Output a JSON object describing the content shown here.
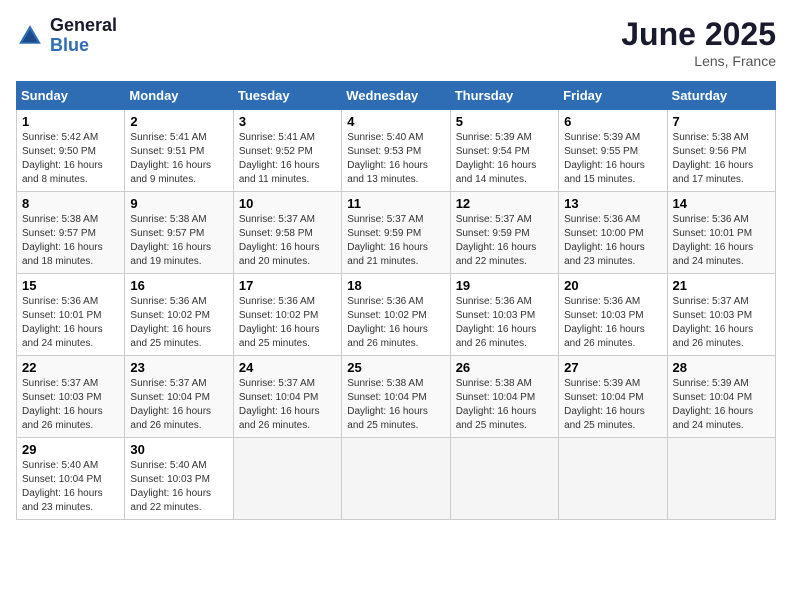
{
  "header": {
    "logo_general": "General",
    "logo_blue": "Blue",
    "month_title": "June 2025",
    "location": "Lens, France"
  },
  "weekdays": [
    "Sunday",
    "Monday",
    "Tuesday",
    "Wednesday",
    "Thursday",
    "Friday",
    "Saturday"
  ],
  "weeks": [
    [
      {
        "day": "1",
        "info": "Sunrise: 5:42 AM\nSunset: 9:50 PM\nDaylight: 16 hours\nand 8 minutes."
      },
      {
        "day": "2",
        "info": "Sunrise: 5:41 AM\nSunset: 9:51 PM\nDaylight: 16 hours\nand 9 minutes."
      },
      {
        "day": "3",
        "info": "Sunrise: 5:41 AM\nSunset: 9:52 PM\nDaylight: 16 hours\nand 11 minutes."
      },
      {
        "day": "4",
        "info": "Sunrise: 5:40 AM\nSunset: 9:53 PM\nDaylight: 16 hours\nand 13 minutes."
      },
      {
        "day": "5",
        "info": "Sunrise: 5:39 AM\nSunset: 9:54 PM\nDaylight: 16 hours\nand 14 minutes."
      },
      {
        "day": "6",
        "info": "Sunrise: 5:39 AM\nSunset: 9:55 PM\nDaylight: 16 hours\nand 15 minutes."
      },
      {
        "day": "7",
        "info": "Sunrise: 5:38 AM\nSunset: 9:56 PM\nDaylight: 16 hours\nand 17 minutes."
      }
    ],
    [
      {
        "day": "8",
        "info": "Sunrise: 5:38 AM\nSunset: 9:57 PM\nDaylight: 16 hours\nand 18 minutes."
      },
      {
        "day": "9",
        "info": "Sunrise: 5:38 AM\nSunset: 9:57 PM\nDaylight: 16 hours\nand 19 minutes."
      },
      {
        "day": "10",
        "info": "Sunrise: 5:37 AM\nSunset: 9:58 PM\nDaylight: 16 hours\nand 20 minutes."
      },
      {
        "day": "11",
        "info": "Sunrise: 5:37 AM\nSunset: 9:59 PM\nDaylight: 16 hours\nand 21 minutes."
      },
      {
        "day": "12",
        "info": "Sunrise: 5:37 AM\nSunset: 9:59 PM\nDaylight: 16 hours\nand 22 minutes."
      },
      {
        "day": "13",
        "info": "Sunrise: 5:36 AM\nSunset: 10:00 PM\nDaylight: 16 hours\nand 23 minutes."
      },
      {
        "day": "14",
        "info": "Sunrise: 5:36 AM\nSunset: 10:01 PM\nDaylight: 16 hours\nand 24 minutes."
      }
    ],
    [
      {
        "day": "15",
        "info": "Sunrise: 5:36 AM\nSunset: 10:01 PM\nDaylight: 16 hours\nand 24 minutes."
      },
      {
        "day": "16",
        "info": "Sunrise: 5:36 AM\nSunset: 10:02 PM\nDaylight: 16 hours\nand 25 minutes."
      },
      {
        "day": "17",
        "info": "Sunrise: 5:36 AM\nSunset: 10:02 PM\nDaylight: 16 hours\nand 25 minutes."
      },
      {
        "day": "18",
        "info": "Sunrise: 5:36 AM\nSunset: 10:02 PM\nDaylight: 16 hours\nand 26 minutes."
      },
      {
        "day": "19",
        "info": "Sunrise: 5:36 AM\nSunset: 10:03 PM\nDaylight: 16 hours\nand 26 minutes."
      },
      {
        "day": "20",
        "info": "Sunrise: 5:36 AM\nSunset: 10:03 PM\nDaylight: 16 hours\nand 26 minutes."
      },
      {
        "day": "21",
        "info": "Sunrise: 5:37 AM\nSunset: 10:03 PM\nDaylight: 16 hours\nand 26 minutes."
      }
    ],
    [
      {
        "day": "22",
        "info": "Sunrise: 5:37 AM\nSunset: 10:03 PM\nDaylight: 16 hours\nand 26 minutes."
      },
      {
        "day": "23",
        "info": "Sunrise: 5:37 AM\nSunset: 10:04 PM\nDaylight: 16 hours\nand 26 minutes."
      },
      {
        "day": "24",
        "info": "Sunrise: 5:37 AM\nSunset: 10:04 PM\nDaylight: 16 hours\nand 26 minutes."
      },
      {
        "day": "25",
        "info": "Sunrise: 5:38 AM\nSunset: 10:04 PM\nDaylight: 16 hours\nand 25 minutes."
      },
      {
        "day": "26",
        "info": "Sunrise: 5:38 AM\nSunset: 10:04 PM\nDaylight: 16 hours\nand 25 minutes."
      },
      {
        "day": "27",
        "info": "Sunrise: 5:39 AM\nSunset: 10:04 PM\nDaylight: 16 hours\nand 25 minutes."
      },
      {
        "day": "28",
        "info": "Sunrise: 5:39 AM\nSunset: 10:04 PM\nDaylight: 16 hours\nand 24 minutes."
      }
    ],
    [
      {
        "day": "29",
        "info": "Sunrise: 5:40 AM\nSunset: 10:04 PM\nDaylight: 16 hours\nand 23 minutes."
      },
      {
        "day": "30",
        "info": "Sunrise: 5:40 AM\nSunset: 10:03 PM\nDaylight: 16 hours\nand 22 minutes."
      },
      {
        "day": "",
        "info": ""
      },
      {
        "day": "",
        "info": ""
      },
      {
        "day": "",
        "info": ""
      },
      {
        "day": "",
        "info": ""
      },
      {
        "day": "",
        "info": ""
      }
    ]
  ]
}
